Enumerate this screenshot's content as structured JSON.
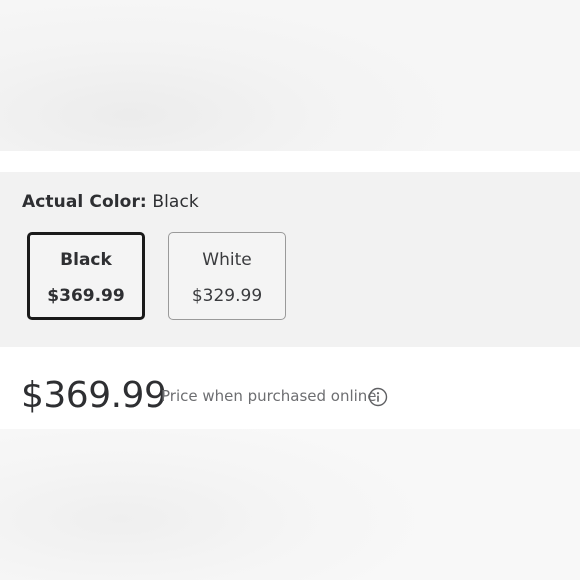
{
  "variant": {
    "label": "Actual Color:",
    "selected_value": "Black",
    "options": [
      {
        "name": "Black",
        "price": "$369.99",
        "selected": true
      },
      {
        "name": "White",
        "price": "$329.99",
        "selected": false
      }
    ]
  },
  "pricing": {
    "price": "$369.99",
    "note": "Price when purchased online",
    "info_icon": "info-icon"
  },
  "colors": {
    "panel_bg": "#f2f2f2",
    "selected_border": "#1a1a1a",
    "unselected_border": "#9a9a9a",
    "text": "#2e2f32",
    "muted_text": "#6d6e71"
  }
}
